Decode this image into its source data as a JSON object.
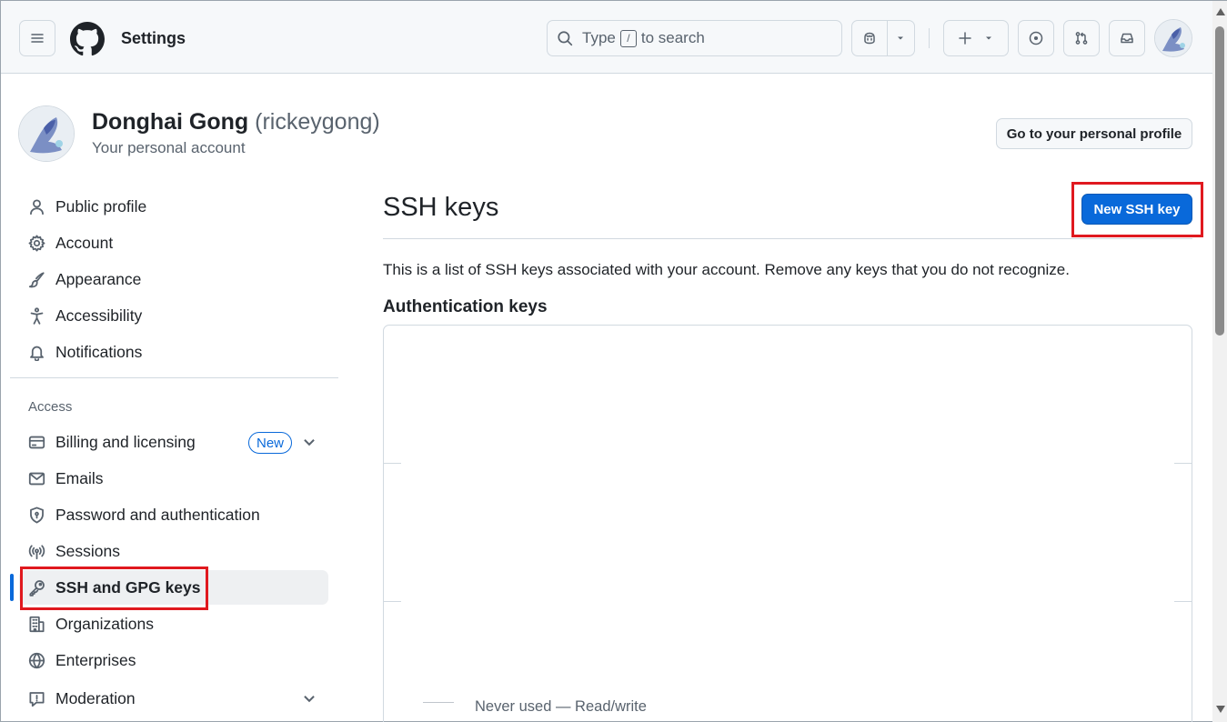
{
  "header": {
    "title": "Settings",
    "search": {
      "before": "Type",
      "key": "/",
      "after": "to search"
    }
  },
  "account": {
    "name": "Donghai Gong",
    "login": "(rickeygong)",
    "subtitle": "Your personal account",
    "profile_button": "Go to your personal profile"
  },
  "sidebar": {
    "items": [
      {
        "label": "Public profile",
        "icon": "person-icon"
      },
      {
        "label": "Account",
        "icon": "gear-icon"
      },
      {
        "label": "Appearance",
        "icon": "paintbrush-icon"
      },
      {
        "label": "Accessibility",
        "icon": "accessibility-icon"
      },
      {
        "label": "Notifications",
        "icon": "bell-icon"
      }
    ],
    "access_heading": "Access",
    "access_items": [
      {
        "label": "Billing and licensing",
        "icon": "credit-card-icon",
        "badge": "New"
      },
      {
        "label": "Emails",
        "icon": "mail-icon"
      },
      {
        "label": "Password and authentication",
        "icon": "shield-lock-icon"
      },
      {
        "label": "Sessions",
        "icon": "broadcast-icon"
      },
      {
        "label": "SSH and GPG keys",
        "icon": "key-icon",
        "active": true
      },
      {
        "label": "Organizations",
        "icon": "organization-icon"
      },
      {
        "label": "Enterprises",
        "icon": "globe-icon"
      },
      {
        "label": "Moderation",
        "icon": "report-icon"
      }
    ]
  },
  "main": {
    "title": "SSH keys",
    "new_button": "New SSH key",
    "intro": "This is a list of SSH keys associated with your account. Remove any keys that you do not recognize.",
    "auth_heading": "Authentication keys",
    "key_meta": "Never used — Read/write"
  },
  "colors": {
    "accent": "#0969da",
    "highlight": "#e0191f",
    "border": "#d1d9e0",
    "muted": "#59636e"
  }
}
